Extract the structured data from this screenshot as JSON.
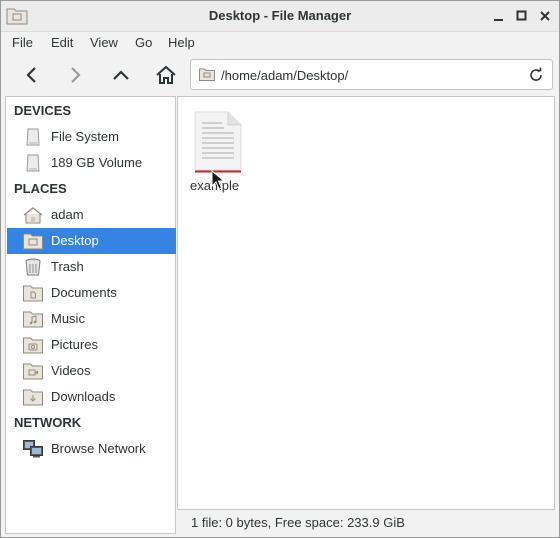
{
  "window": {
    "title": "Desktop - File Manager"
  },
  "menu": {
    "items": [
      "File",
      "Edit",
      "View",
      "Go",
      "Help"
    ]
  },
  "toolbar": {
    "back_icon": "back-arrow-icon",
    "forward_icon": "forward-arrow-icon",
    "up_icon": "up-arrow-icon",
    "home_icon": "home-icon"
  },
  "location": {
    "path": "/home/adam/Desktop/"
  },
  "sidebar": {
    "devices_header": "DEVICES",
    "devices": [
      {
        "label": "File System",
        "icon": "drive-icon"
      },
      {
        "label": "189 GB Volume",
        "icon": "drive-icon"
      }
    ],
    "places_header": "PLACES",
    "places": [
      {
        "label": "adam",
        "icon": "home-folder-icon"
      },
      {
        "label": "Desktop",
        "icon": "desktop-folder-icon",
        "selected": true
      },
      {
        "label": "Trash",
        "icon": "trash-icon"
      },
      {
        "label": "Documents",
        "icon": "documents-folder-icon"
      },
      {
        "label": "Music",
        "icon": "music-folder-icon"
      },
      {
        "label": "Pictures",
        "icon": "pictures-folder-icon"
      },
      {
        "label": "Videos",
        "icon": "videos-folder-icon"
      },
      {
        "label": "Downloads",
        "icon": "downloads-folder-icon"
      }
    ],
    "network_header": "NETWORK",
    "network": [
      {
        "label": "Browse Network",
        "icon": "network-icon"
      }
    ]
  },
  "files": [
    {
      "name": "example",
      "icon": "text-file-icon"
    }
  ],
  "status": {
    "text": "1 file: 0 bytes, Free space: 233.9 GiB"
  },
  "colors": {
    "selection": "#3584e4",
    "window_bg": "#f2f2f2"
  }
}
